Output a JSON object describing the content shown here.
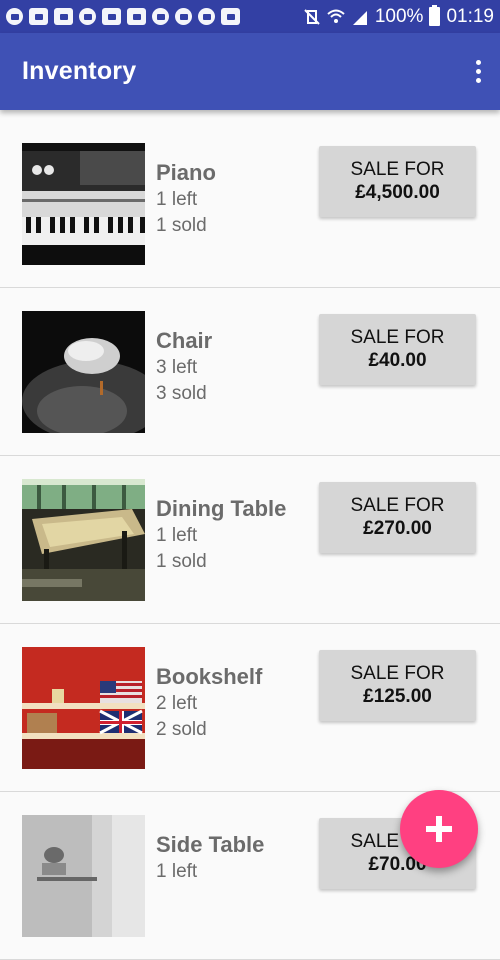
{
  "status_bar": {
    "battery_percent": "100%",
    "time": "01:19",
    "icons": [
      "location-icon",
      "gmail-icon",
      "skype-icon",
      "data-saver-icon",
      "instagram-icon",
      "linkedin-icon",
      "upload-icon",
      "upload-icon",
      "upload-icon",
      "bag-icon",
      "mute-vibrate-icon",
      "wifi-icon",
      "signal-icon",
      "battery-icon"
    ]
  },
  "app_bar": {
    "title": "Inventory",
    "menu_icon": "more-vert-icon"
  },
  "items": [
    {
      "name": "Piano",
      "left": "1 left",
      "sold": "1 sold",
      "button_line1": "SALE FOR",
      "button_line2": "£4,500.00"
    },
    {
      "name": "Chair",
      "left": "3 left",
      "sold": "3 sold",
      "button_line1": "SALE FOR",
      "button_line2": "£40.00"
    },
    {
      "name": "Dining Table",
      "left": "1 left",
      "sold": "1 sold",
      "button_line1": "SALE FOR",
      "button_line2": "£270.00"
    },
    {
      "name": "Bookshelf",
      "left": "2 left",
      "sold": "2 sold",
      "button_line1": "SALE FOR",
      "button_line2": "£125.00"
    },
    {
      "name": "Side Table",
      "left": "1 left",
      "sold": "",
      "button_line1": "SALE FOR",
      "button_line2": "£70.00"
    }
  ],
  "fab": {
    "icon": "add-icon"
  }
}
